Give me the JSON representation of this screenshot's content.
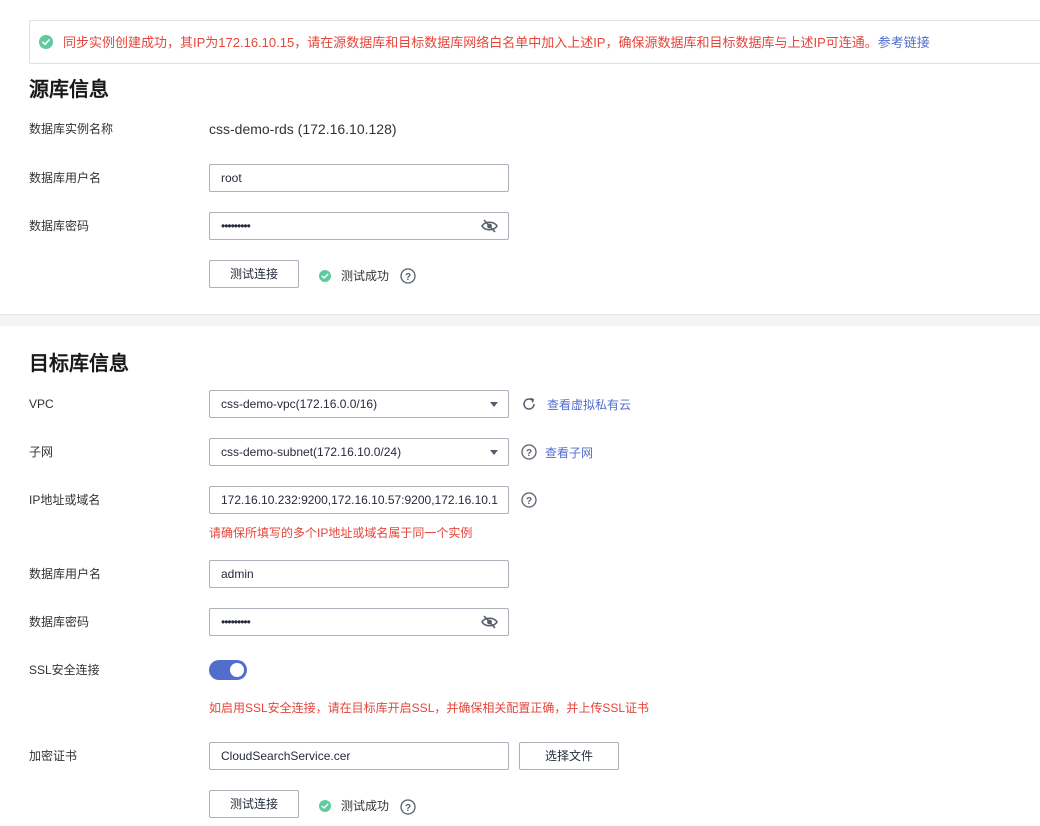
{
  "alert": {
    "message": "同步实例创建成功，其IP为172.16.10.15，请在源数据库和目标数据库网络白名单中加入上述IP，确保源数据库和目标数据库与上述IP可连通。",
    "link": "参考链接"
  },
  "source": {
    "title": "源库信息",
    "instance_label": "数据库实例名称",
    "instance_value": "css-demo-rds (172.16.10.128)",
    "user_label": "数据库用户名",
    "user_value": "root",
    "password_label": "数据库密码",
    "password_value": "•••••••••",
    "test_button": "测试连接",
    "test_status": "测试成功"
  },
  "target": {
    "title": "目标库信息",
    "vpc_label": "VPC",
    "vpc_value": "css-demo-vpc(172.16.0.0/16)",
    "vpc_link": "查看虚拟私有云",
    "subnet_label": "子网",
    "subnet_value": "css-demo-subnet(172.16.10.0/24)",
    "subnet_link": "查看子网",
    "ip_label": "IP地址或域名",
    "ip_value": "172.16.10.232:9200,172.16.10.57:9200,172.16.10.1",
    "ip_hint": "请确保所填写的多个IP地址或域名属于同一个实例",
    "user_label": "数据库用户名",
    "user_value": "admin",
    "password_label": "数据库密码",
    "password_value": "•••••••••",
    "ssl_label": "SSL安全连接",
    "ssl_enabled": true,
    "ssl_hint": "如启用SSL安全连接，请在目标库开启SSL，并确保相关配置正确，并上传SSL证书",
    "cert_label": "加密证书",
    "cert_value": "CloudSearchService.cer",
    "choose_file_button": "选择文件",
    "test_button": "测试连接",
    "test_status": "测试成功"
  },
  "colors": {
    "accent": "#526ecc",
    "success": "#5dcaa0",
    "error": "#e5453b"
  }
}
